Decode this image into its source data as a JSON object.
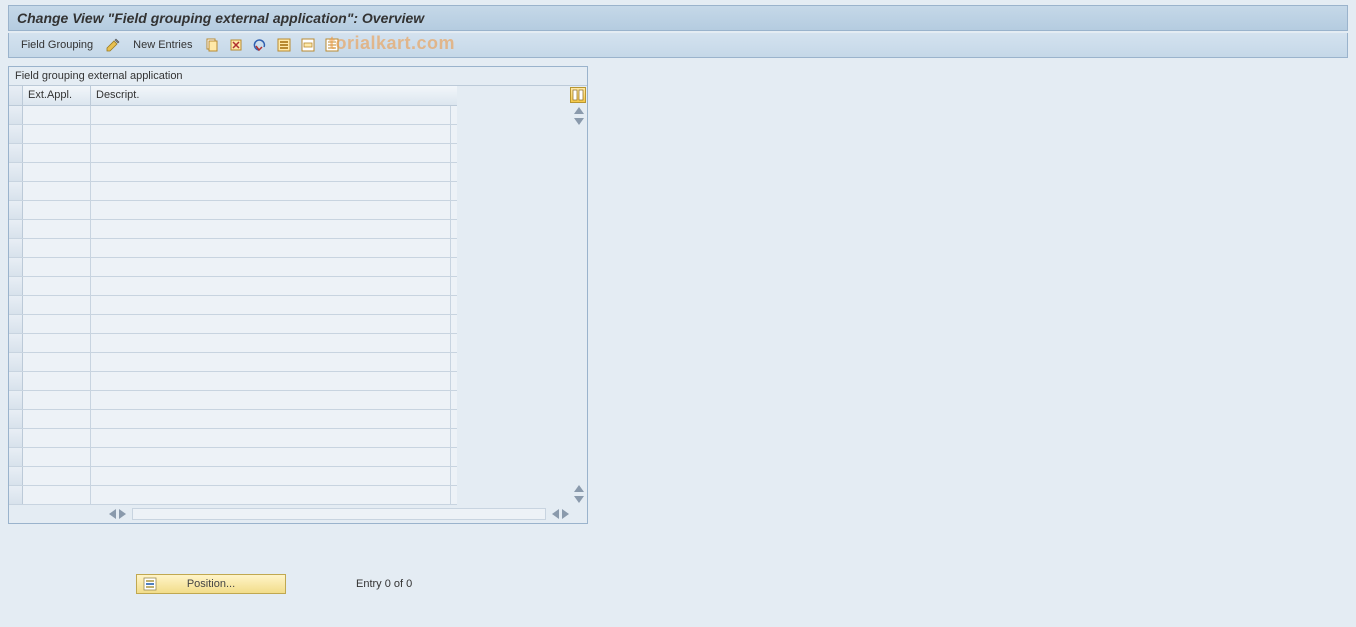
{
  "title": "Change View \"Field grouping external application\": Overview",
  "toolbar": {
    "field_grouping": "Field Grouping",
    "new_entries": "New Entries"
  },
  "watermark": "torialkart.com",
  "panel": {
    "header": "Field grouping external application",
    "columns": {
      "ext_appl": "Ext.Appl.",
      "descript": "Descript."
    },
    "rows": [
      {
        "ext": "",
        "desc": ""
      },
      {
        "ext": "",
        "desc": ""
      },
      {
        "ext": "",
        "desc": ""
      },
      {
        "ext": "",
        "desc": ""
      },
      {
        "ext": "",
        "desc": ""
      },
      {
        "ext": "",
        "desc": ""
      },
      {
        "ext": "",
        "desc": ""
      },
      {
        "ext": "",
        "desc": ""
      },
      {
        "ext": "",
        "desc": ""
      },
      {
        "ext": "",
        "desc": ""
      },
      {
        "ext": "",
        "desc": ""
      },
      {
        "ext": "",
        "desc": ""
      },
      {
        "ext": "",
        "desc": ""
      },
      {
        "ext": "",
        "desc": ""
      },
      {
        "ext": "",
        "desc": ""
      },
      {
        "ext": "",
        "desc": ""
      },
      {
        "ext": "",
        "desc": ""
      },
      {
        "ext": "",
        "desc": ""
      },
      {
        "ext": "",
        "desc": ""
      },
      {
        "ext": "",
        "desc": ""
      },
      {
        "ext": "",
        "desc": ""
      }
    ]
  },
  "footer": {
    "position_label": "Position...",
    "entry_text": "Entry 0 of 0"
  }
}
